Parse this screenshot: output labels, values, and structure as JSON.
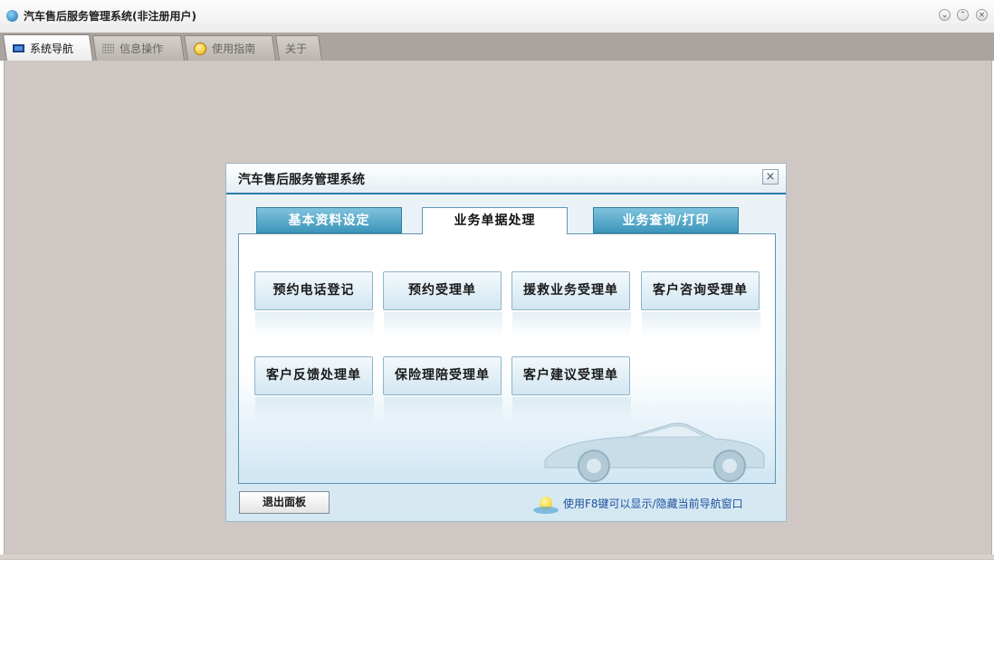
{
  "window": {
    "title": "汽车售后服务管理系统(非注册用户)",
    "controls": {
      "minimize_icon": "⌄",
      "restore_icon": "⌃",
      "close_icon": "×"
    }
  },
  "main_tabs": [
    {
      "label": "系统导航",
      "icon": "monitor-icon",
      "active": true
    },
    {
      "label": "信息操作",
      "icon": "grid-icon",
      "active": false
    },
    {
      "label": "使用指南",
      "icon": "help-icon",
      "active": false
    },
    {
      "label": "关于",
      "icon": "",
      "active": false
    }
  ],
  "dialog": {
    "title": "汽车售后服务管理系统",
    "close_icon": "×",
    "tabs": [
      {
        "label": "基本资料设定",
        "active": false
      },
      {
        "label": "业务单据处理",
        "active": true
      },
      {
        "label": "业务查询/打印",
        "active": false
      }
    ],
    "function_buttons": [
      "预约电话登记",
      "预约受理单",
      "援救业务受理单",
      "客户咨询受理单",
      "客户反馈处理单",
      "保险理陪受理单",
      "客户建议受理单"
    ],
    "exit_label": "退出面板",
    "hint": "使用F8键可以显示/隐藏当前导航窗口"
  },
  "colors": {
    "workspace": "#cec7c3",
    "tab_active": "#ffffff",
    "dialog_accent": "#2d7aa8",
    "dialog_tab": "#3b95ba",
    "hint_text": "#1e4f9e"
  }
}
